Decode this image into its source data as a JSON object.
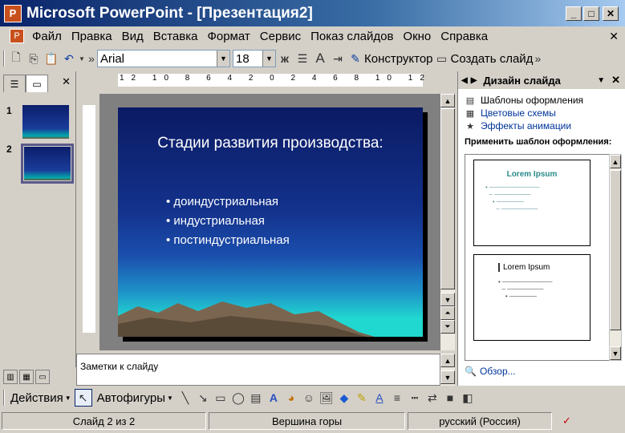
{
  "window": {
    "title": "Microsoft PowerPoint - [Презентация2]",
    "app_icon": "P"
  },
  "menu": [
    "Файл",
    "Правка",
    "Вид",
    "Вставка",
    "Формат",
    "Сервис",
    "Показ слайдов",
    "Окно",
    "Справка"
  ],
  "toolbar": {
    "font": "Arial",
    "size": "18",
    "bold": "ж",
    "designer": "Конструктор",
    "new_slide": "Создать слайд"
  },
  "slide_pane": {
    "thumbs": [
      "1",
      "2"
    ],
    "selected": "2"
  },
  "slide": {
    "title": "Стадии развития производства:",
    "bullets": [
      "доиндустриальная",
      "индустриальная",
      "постиндустриальная"
    ]
  },
  "ruler_h": "12 10 8 6 4 2 0 2 4 6 8 10 12",
  "notes_placeholder": "Заметки к слайду",
  "task_pane": {
    "title": "Дизайн слайда",
    "links": [
      "Шаблоны оформления",
      "Цветовые схемы",
      "Эффекты анимации"
    ],
    "apply_label": "Применить шаблон оформления:",
    "template1_title": "Lorem Ipsum",
    "template2_title": "Lorem Ipsum",
    "browse": "Обзор..."
  },
  "drawing": {
    "actions": "Действия",
    "autoshapes": "Автофигуры"
  },
  "status": {
    "slide": "Слайд 2 из 2",
    "design": "Вершина горы",
    "language": "русский (Россия)"
  }
}
